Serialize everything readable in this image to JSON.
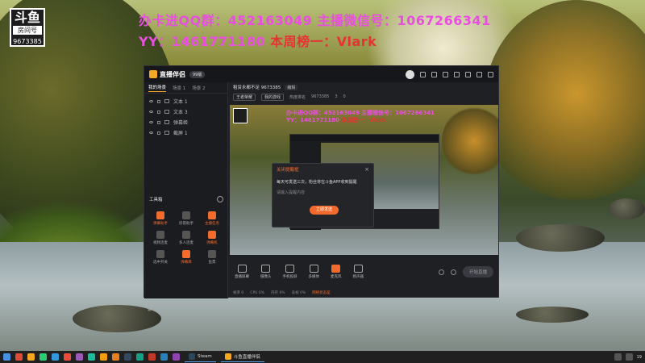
{
  "overlay": {
    "logo_text": "斗鱼",
    "logo_sub": "房间号",
    "logo_room": "9673385",
    "line1": "办卡进QQ群：452163049  主播微信号：1067266341",
    "line2_prefix": "YY：1461771180",
    "line2_rank": "本周榜一：Vlark"
  },
  "app": {
    "name": "直播伴侣",
    "version": "99版",
    "titlebar_icons": [
      "avatar",
      "gift-icon",
      "lock-icon",
      "shirt-icon",
      "settings-icon",
      "minimize-icon",
      "maximize-icon",
      "close-icon"
    ]
  },
  "scenes": {
    "tabs": [
      {
        "label": "我的场景",
        "active": true
      },
      {
        "label": "场景 1",
        "active": false
      },
      {
        "label": "场景 2",
        "active": false
      }
    ],
    "sources": [
      {
        "label": "文本 1"
      },
      {
        "label": "文本 3"
      },
      {
        "label": "弹幕姬"
      },
      {
        "label": "截屏 1"
      }
    ]
  },
  "toolbox": {
    "title": "工具箱",
    "tools": [
      {
        "label": "弹幕助手",
        "highlight": true
      },
      {
        "label": "房管助手",
        "highlight": false
      },
      {
        "label": "主播任务",
        "highlight": true
      },
      {
        "label": "视频连麦",
        "highlight": false
      },
      {
        "label": "多人连麦",
        "highlight": false
      },
      {
        "label": "弹幕机",
        "highlight": true
      },
      {
        "label": "选中开关",
        "highlight": false
      },
      {
        "label": "弹幕库",
        "highlight": true
      },
      {
        "label": "鱼票",
        "highlight": false
      }
    ]
  },
  "room": {
    "title": "租赁永都不足 9673385",
    "edit_tag": "编辑",
    "category_chip": "王者荣耀",
    "category2_chip": "我的游戏",
    "hot_label": "热度排名",
    "hot_value": "9673385",
    "fans": "3",
    "likes": "0"
  },
  "preview": {
    "line1": "办卡进QQ群：452163049  主播微信号：1067266341",
    "line2_prefix": "YY：1461771180",
    "line2_rank": "本周榜一：Vlark"
  },
  "dialog": {
    "title": "关闭提醒框",
    "body": "每天可发送三次，粉丝将在斗鱼APP收到提醒",
    "sub": "请输入提醒内容",
    "button": "立即发送"
  },
  "bottom_tools": [
    {
      "label": "直播屏幕",
      "highlight": false
    },
    {
      "label": "摄像头",
      "highlight": false
    },
    {
      "label": "手机投屏",
      "highlight": false
    },
    {
      "label": "多媒体",
      "highlight": false
    },
    {
      "label": "麦克风",
      "highlight": true
    },
    {
      "label": "扬声器",
      "highlight": false
    }
  ],
  "start_button": "开始直播",
  "status": {
    "items": [
      "帧率 0",
      "CPU 0%",
      "内存 0%",
      "丢帧 0%"
    ],
    "warning": "网络状态差"
  },
  "left_status": "斗鱼公众号：请勿相信个人小号拉群，谨防上当受骗",
  "taskbar": {
    "apps": [
      {
        "label": "Steam"
      },
      {
        "label": "斗鱼直播伴侣"
      }
    ],
    "tray_time": "19"
  }
}
